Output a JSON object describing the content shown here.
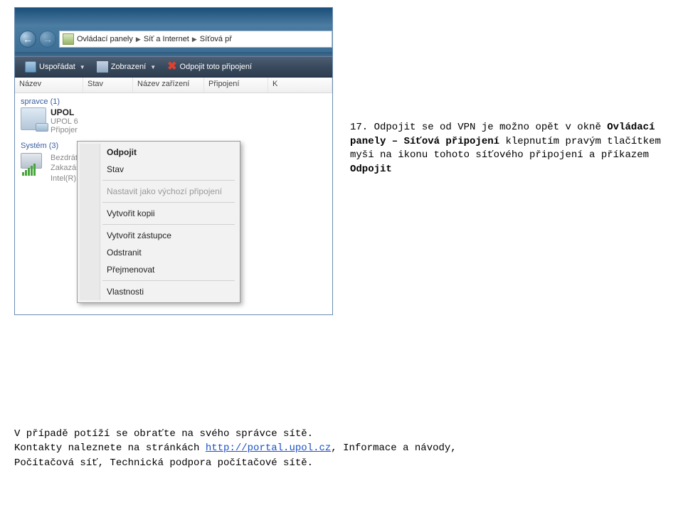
{
  "breadcrumb": {
    "item1": "Ovládací panely",
    "item2": "Síť a Internet",
    "item3": "Síťová př"
  },
  "toolbar": {
    "organize": "Uspořádat",
    "views": "Zobrazení",
    "disconnect": "Odpojit toto připojení"
  },
  "columns": {
    "name": "Název",
    "status": "Stav",
    "device": "Název zařízení",
    "connection": "Připojení",
    "k": "K"
  },
  "groups": {
    "spravce": "spravce (1)",
    "systemLabel": "Systém (3)"
  },
  "upol": {
    "title": "UPOL",
    "sub1": "UPOL 6",
    "sub2": "Připojer"
  },
  "system": {
    "l1": "Bezdrátc",
    "l2": "Zakazán",
    "l3": "Intel(R)"
  },
  "contextMenu": {
    "items": [
      {
        "label": "Odpojit",
        "bold": true
      },
      {
        "label": "Stav"
      },
      {
        "sep": true
      },
      {
        "label": "Nastavit jako výchozí připojení",
        "disabled": true
      },
      {
        "sep": true
      },
      {
        "label": "Vytvořit kopii"
      },
      {
        "sep": true
      },
      {
        "label": "Vytvořit zástupce"
      },
      {
        "label": "Odstranit"
      },
      {
        "label": "Přejmenovat"
      },
      {
        "sep": true
      },
      {
        "label": "Vlastnosti"
      }
    ]
  },
  "docText": {
    "prefix": "17. Odpojit se od VPN je možno opět v okně ",
    "bold1": "Ovládací panely – Síťová připojení",
    "mid": " klepnutím pravým tlačítkem myši na ikonu tohoto síťového připojení a příkazem ",
    "bold2": "Odpojit"
  },
  "footer": {
    "line1a": "V případě potíží se obraťte na svého správce sítě.",
    "line2a": "Kontakty naleznete na stránkách ",
    "linkText": "http://portal.upol.cz",
    "line2b": ", Informace a návody,",
    "line3": "Počítačová síť, Technická podpora počítačové sítě."
  }
}
